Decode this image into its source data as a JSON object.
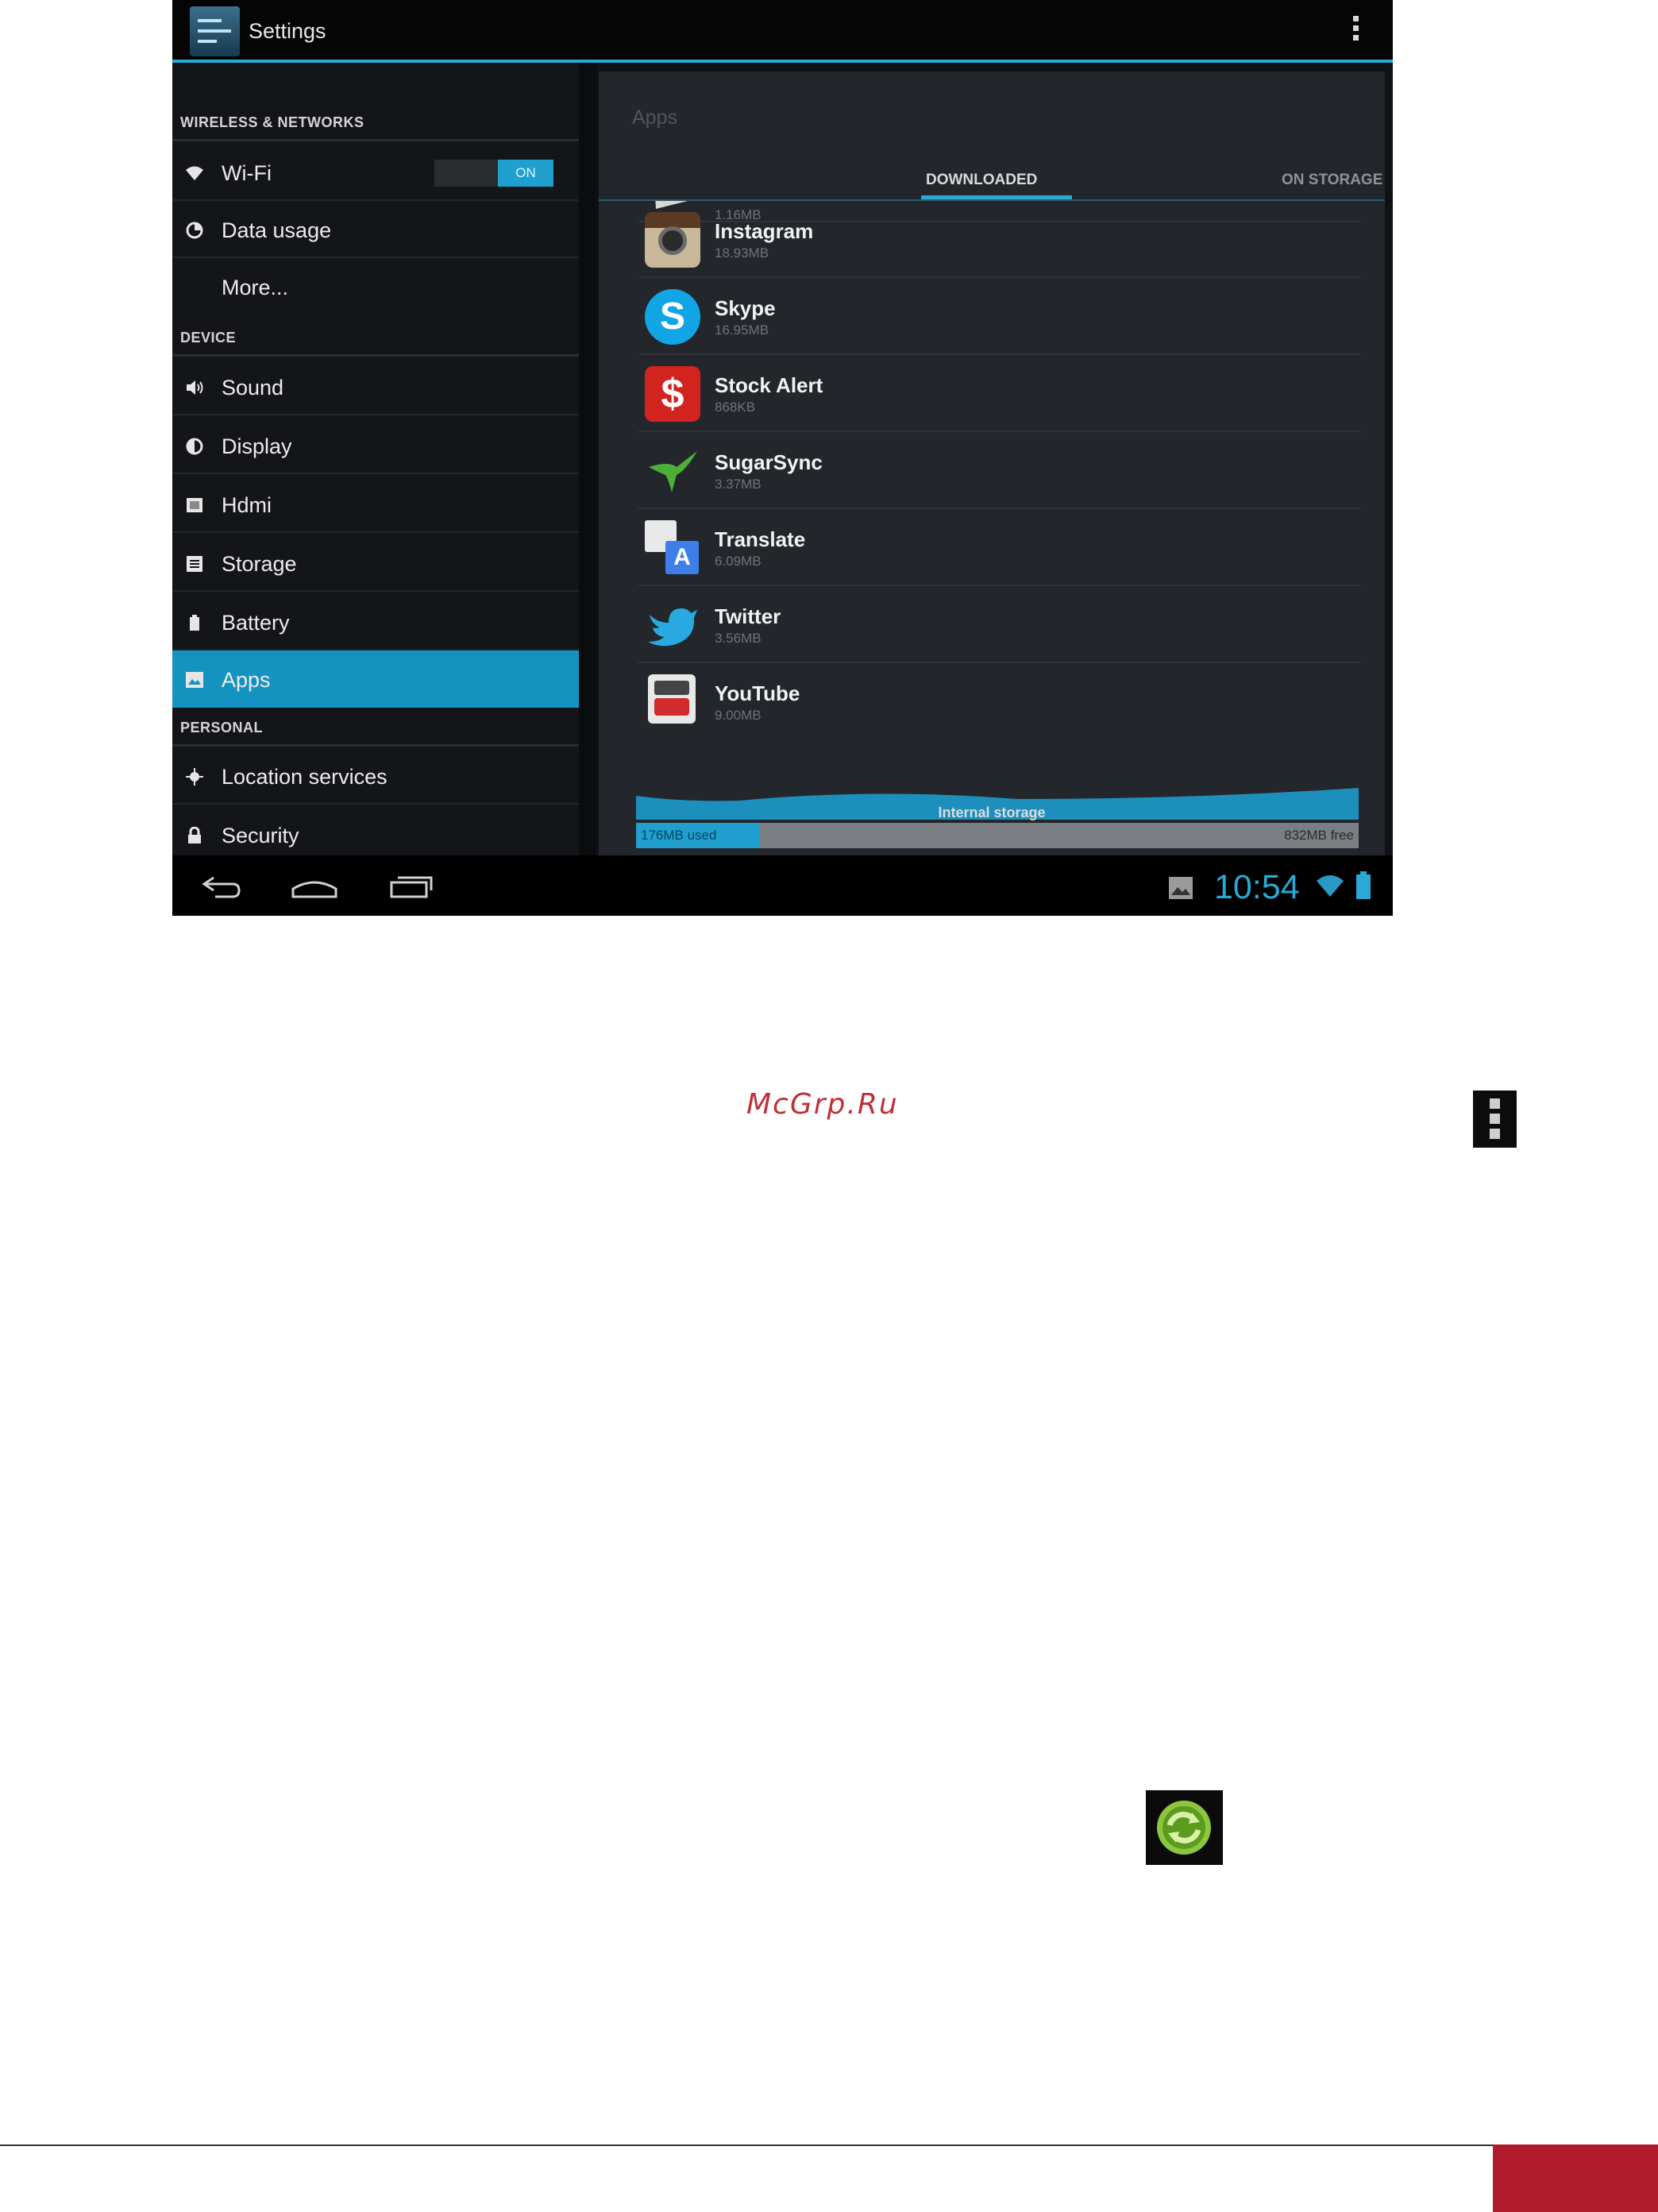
{
  "actionbar": {
    "title": "Settings",
    "app_icon": "settings-icon",
    "overflow_icon": "overflow-menu-icon"
  },
  "nav": {
    "sections": [
      {
        "header": "WIRELESS & NETWORKS"
      },
      {
        "header": "DEVICE"
      },
      {
        "header": "PERSONAL"
      }
    ],
    "items": [
      {
        "label": "Wi-Fi",
        "icon": "wifi-icon",
        "toggle": "ON"
      },
      {
        "label": "Data usage",
        "icon": "data-usage-icon"
      },
      {
        "label": "More...",
        "icon": ""
      },
      {
        "label": "Sound",
        "icon": "sound-icon"
      },
      {
        "label": "Display",
        "icon": "display-icon"
      },
      {
        "label": "Hdmi",
        "icon": "hdmi-icon"
      },
      {
        "label": "Storage",
        "icon": "storage-icon"
      },
      {
        "label": "Battery",
        "icon": "battery-icon"
      },
      {
        "label": "Apps",
        "icon": "apps-icon",
        "selected": true
      },
      {
        "label": "Location services",
        "icon": "location-icon"
      },
      {
        "label": "Security",
        "icon": "lock-icon"
      }
    ]
  },
  "content": {
    "title": "Apps",
    "tabs": [
      {
        "label": "DOWNLOADED",
        "active": true
      },
      {
        "label": "ON STORAGE"
      }
    ],
    "apps": [
      {
        "name": "",
        "size": "1.16MB",
        "icon": "partial-app-icon"
      },
      {
        "name": "Instagram",
        "size": "18.93MB",
        "icon": "instagram-icon"
      },
      {
        "name": "Skype",
        "size": "16.95MB",
        "icon": "skype-icon"
      },
      {
        "name": "Stock Alert",
        "size": "868KB",
        "icon": "stock-alert-icon"
      },
      {
        "name": "SugarSync",
        "size": "3.37MB",
        "icon": "sugarsync-icon"
      },
      {
        "name": "Translate",
        "size": "6.09MB",
        "icon": "translate-icon"
      },
      {
        "name": "Twitter",
        "size": "3.56MB",
        "icon": "twitter-icon"
      },
      {
        "name": "YouTube",
        "size": "9.00MB",
        "icon": "youtube-icon"
      }
    ],
    "storage": {
      "label": "Internal storage",
      "used": "176MB used",
      "free": "832MB free",
      "used_fraction": 0.17
    }
  },
  "sysbar": {
    "time": "10:54",
    "buttons": [
      "back-icon",
      "home-icon",
      "recent-apps-icon"
    ]
  },
  "page": {
    "watermark": "McGrp.Ru"
  },
  "colors": {
    "accent": "#2aa9d6",
    "selected": "#1593c0",
    "brand": "#b01c2e"
  }
}
